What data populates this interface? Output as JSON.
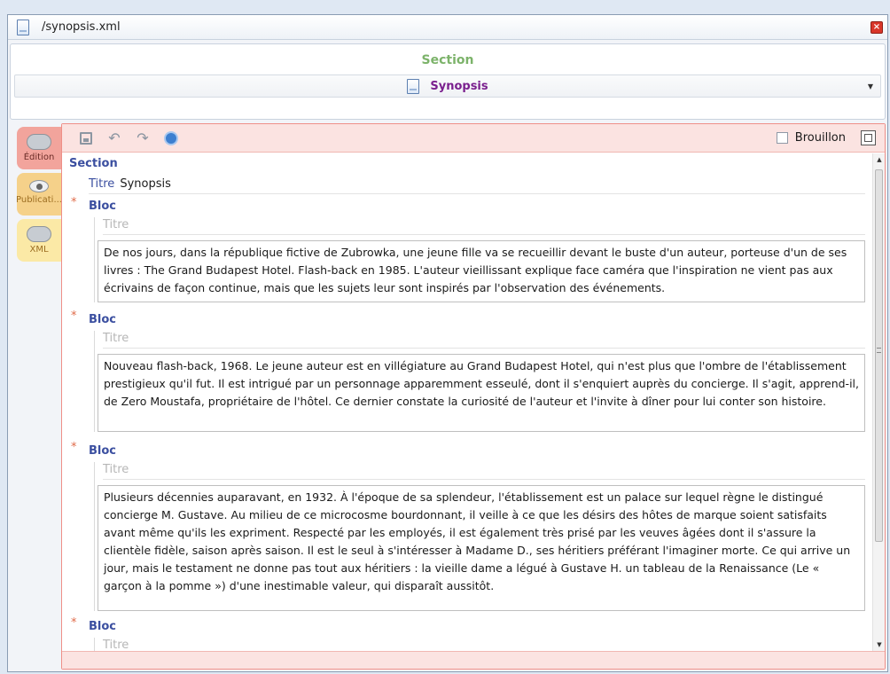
{
  "window": {
    "title": "/synopsis.xml",
    "close": "×"
  },
  "header": {
    "section_label": "Section",
    "selected_section": "Synopsis"
  },
  "side_tabs": [
    {
      "label": "Édition",
      "icon": "edit-icon"
    },
    {
      "label": "Publicati...",
      "icon": "eye-icon"
    },
    {
      "label": "XML",
      "icon": "xml-icon"
    }
  ],
  "toolbar": {
    "draft_label": "Brouillon",
    "draft_checked": false
  },
  "document": {
    "section_title": "Section",
    "titre_label": "Titre",
    "titre_value": "Synopsis",
    "blocs": [
      {
        "label": "Bloc",
        "titre_placeholder": "Titre",
        "text": "De nos jours, dans la république fictive de Zubrowka, une jeune fille va se recueillir devant le buste d'un auteur, porteuse d'un de ses livres : The Grand Budapest Hotel. Flash-back en 1985. L'auteur vieillissant explique face caméra que l'inspiration ne vient pas aux écrivains de façon continue, mais que les sujets leur sont inspirés par l'observation des événements."
      },
      {
        "label": "Bloc",
        "titre_placeholder": "Titre",
        "text": "Nouveau flash-back, 1968. Le jeune auteur est en villégiature au Grand Budapest Hotel, qui n'est plus que l'ombre de l'établissement prestigieux qu'il fut. Il est intrigué par un personnage apparemment esseulé, dont il s'enquiert auprès du concierge. Il s'agit, apprend-il, de Zero Moustafa, propriétaire de l'hôtel. Ce dernier constate la curiosité de l'auteur et l'invite à dîner pour lui conter son histoire."
      },
      {
        "label": "Bloc",
        "titre_placeholder": "Titre",
        "text": "Plusieurs décennies auparavant, en 1932. À l'époque de sa splendeur, l'établissement est un palace sur lequel règne le distingué concierge M. Gustave. Au milieu de ce microcosme bourdonnant, il veille à ce que les désirs des hôtes de marque soient satisfaits avant même qu'ils les expriment. Respecté par les employés, il est également très prisé par les veuves âgées dont il s'assure la clientèle fidèle, saison après saison. Il est le seul à s'intéresser à Madame D., ses héritiers préférant l'imaginer morte. Ce qui arrive un jour, mais le testament ne donne pas tout aux héritiers : la vieille dame a légué à Gustave H. un tableau de la Renaissance (Le « garçon à la pomme ») d'une inestimable valeur, qui disparaît aussitôt."
      },
      {
        "label": "Bloc",
        "titre_placeholder": "Titre"
      }
    ]
  },
  "colors": {
    "section_green": "#7cb36a",
    "synopsis_purple": "#7a1f8e",
    "label_blue": "#3b4fa0",
    "accent_red": "#ef8f88"
  }
}
